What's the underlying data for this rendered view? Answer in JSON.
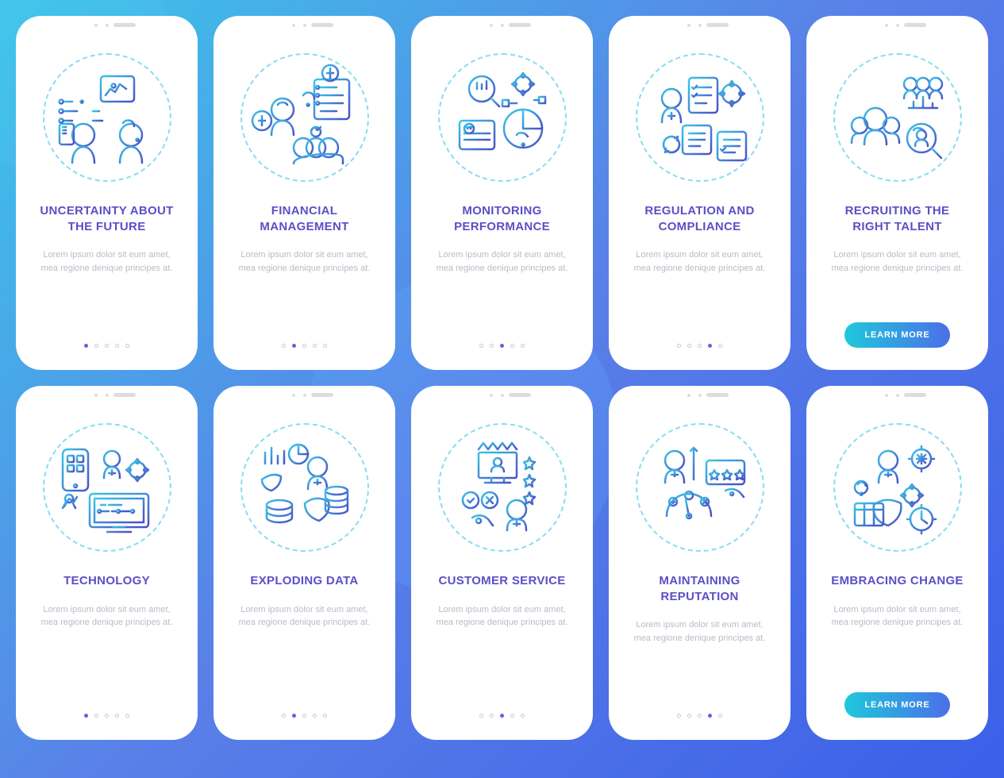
{
  "lorem": "Lorem ipsum dolor sit eum amet, mea regione denique principes at.",
  "cta": "LEARN MORE",
  "cards": [
    {
      "title": "UNCERTAINTY ABOUT THE FUTURE",
      "active": 0,
      "hasButton": false
    },
    {
      "title": "FINANCIAL MANAGEMENT",
      "active": 1,
      "hasButton": false
    },
    {
      "title": "MONITORING PERFORMANCE",
      "active": 2,
      "hasButton": false
    },
    {
      "title": "REGULATION AND COMPLIANCE",
      "active": 3,
      "hasButton": false
    },
    {
      "title": "RECRUITING THE RIGHT TALENT",
      "active": 4,
      "hasButton": true
    },
    {
      "title": "TECHNOLOGY",
      "active": 0,
      "hasButton": false
    },
    {
      "title": "EXPLODING DATA",
      "active": 1,
      "hasButton": false
    },
    {
      "title": "CUSTOMER SERVICE",
      "active": 2,
      "hasButton": false
    },
    {
      "title": "MAINTAINING REPUTATION",
      "active": 3,
      "hasButton": false
    },
    {
      "title": "EMBRACING CHANGE",
      "active": 4,
      "hasButton": true
    }
  ]
}
